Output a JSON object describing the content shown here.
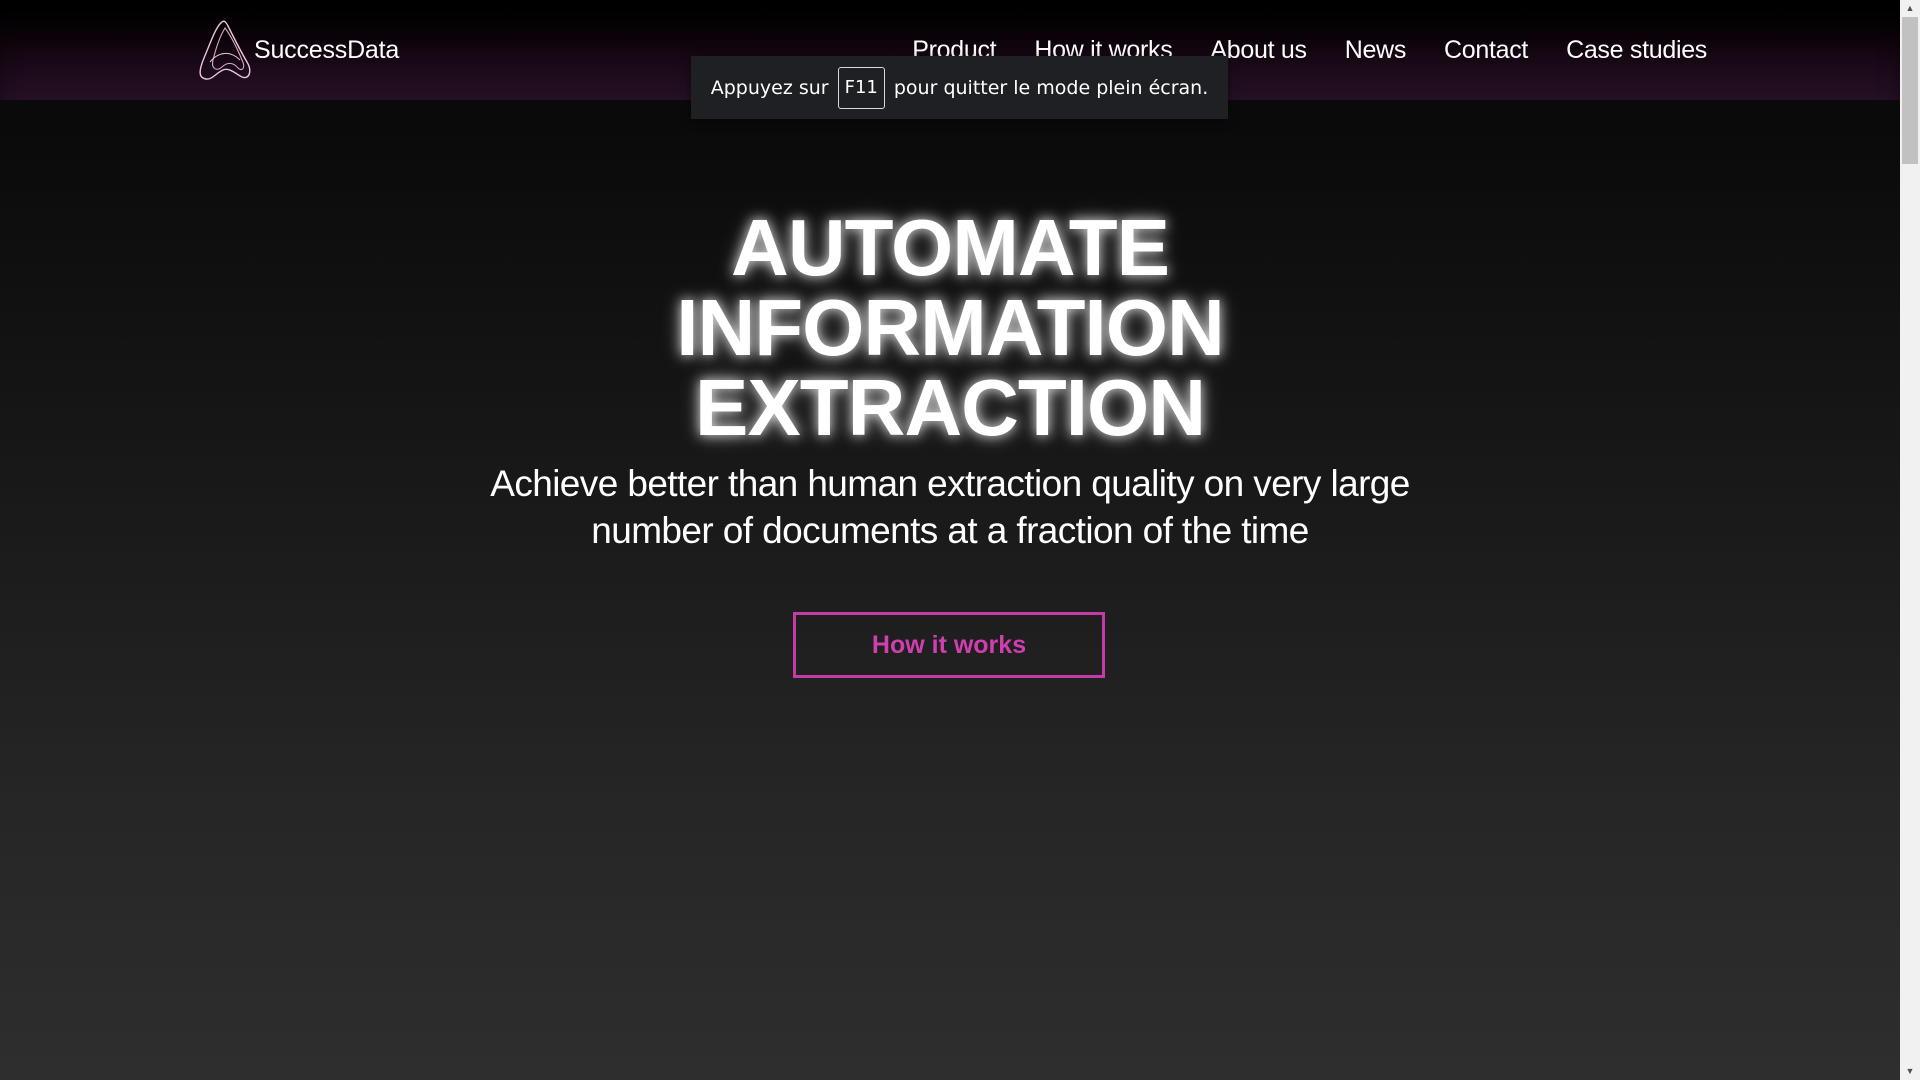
{
  "brand": {
    "name": "SuccessData",
    "logo_icon": "successdata-logo-icon"
  },
  "nav": {
    "items": [
      {
        "label": "Product"
      },
      {
        "label": "How it works"
      },
      {
        "label": "About us"
      },
      {
        "label": "News"
      },
      {
        "label": "Contact"
      },
      {
        "label": "Case studies"
      }
    ]
  },
  "fullscreen_notice": {
    "prefix": "Appuyez sur",
    "key": "F11",
    "suffix": "pour quitter le mode plein écran."
  },
  "hero": {
    "title_lines": [
      "AUTOMATE",
      "INFORMATION",
      "EXTRACTION"
    ],
    "subtitle": "Achieve better than human extraction quality on very large number of documents at a fraction of the time",
    "cta_label": "How it works"
  },
  "colors": {
    "accent": "#c53aa6",
    "header_bg": "#251024",
    "page_bg_top": "#0a0a0a",
    "page_bg_bottom": "#2e2e2e"
  }
}
